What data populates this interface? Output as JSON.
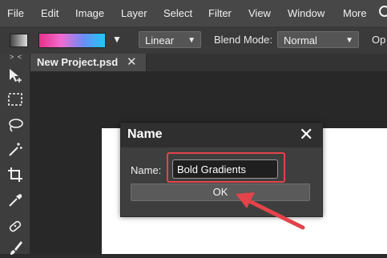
{
  "menubar": {
    "items": [
      "File",
      "Edit",
      "Image",
      "Layer",
      "Select",
      "Filter",
      "View",
      "Window",
      "More"
    ]
  },
  "options": {
    "gradient_type": "Linear",
    "blend_mode_label": "Blend Mode:",
    "blend_mode_value": "Normal",
    "opacity_label": "Op"
  },
  "toolbar": {
    "collapse_label": "> <",
    "tools": [
      "move-tool-icon",
      "marquee-tool-icon",
      "lasso-tool-icon",
      "magic-wand-icon",
      "crop-tool-icon",
      "eyedropper-icon",
      "healing-brush-icon",
      "brush-tool-icon"
    ]
  },
  "document": {
    "tab_title": "New Project.psd",
    "tab_close": "✕"
  },
  "dialog": {
    "title": "Name",
    "close": "✕",
    "field_label": "Name:",
    "name_value": "Bold Gradients",
    "ok_label": "OK"
  },
  "colors": {
    "annotation": "#e3434a",
    "menubar_bg": "#474747",
    "canvas_bg": "#ffffff"
  }
}
